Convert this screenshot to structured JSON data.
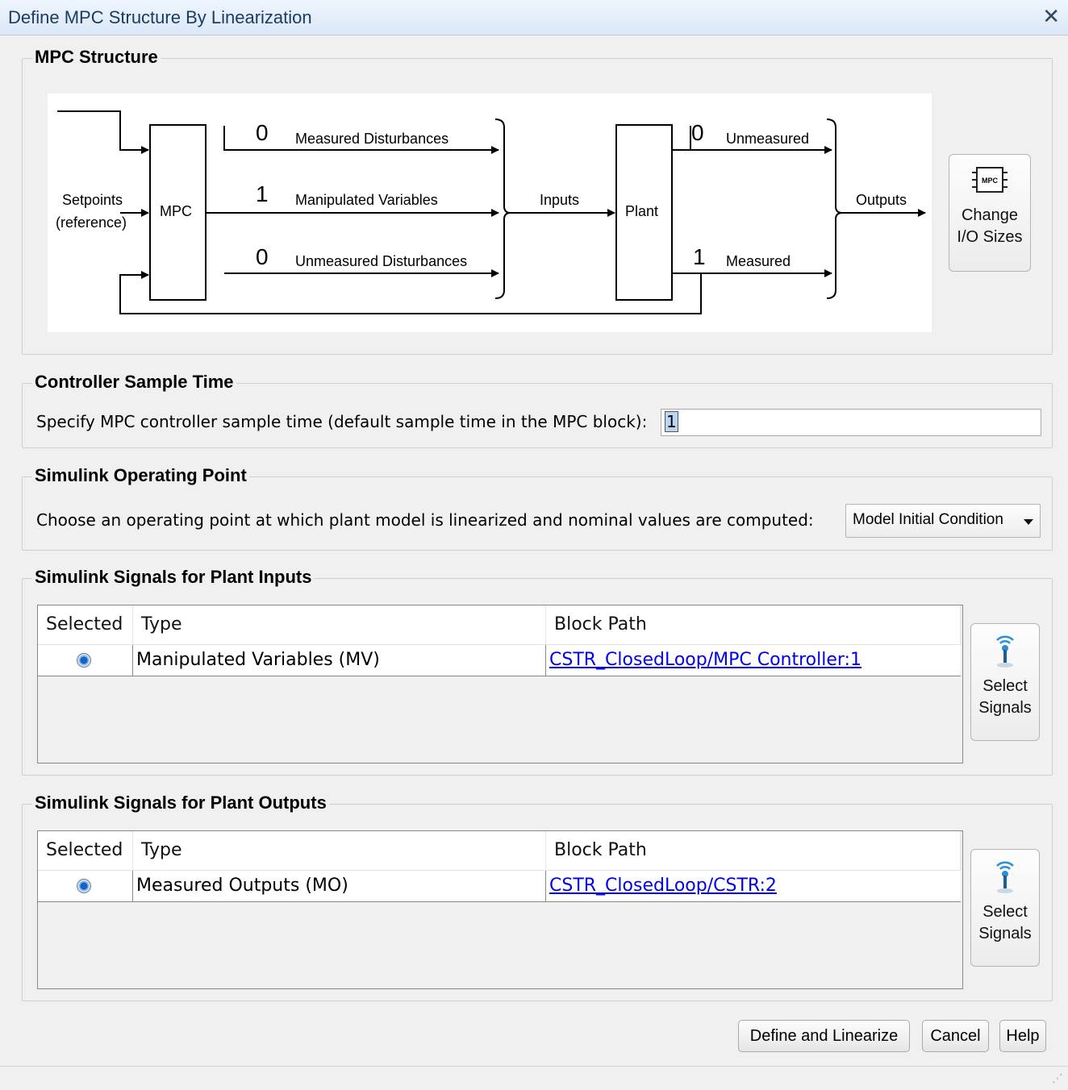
{
  "window": {
    "title": "Define MPC Structure By Linearization",
    "close_glyph": "✕"
  },
  "mpc_structure": {
    "legend": "MPC Structure",
    "diagram": {
      "setpoints_label": "Setpoints",
      "reference_label": "(reference)",
      "mpc_block": "MPC",
      "plant_block": "Plant",
      "inputs_label": "Inputs",
      "outputs_label": "Outputs",
      "measured_disturbances_count": "0",
      "measured_disturbances_label": "Measured Disturbances",
      "manipulated_variables_count": "1",
      "manipulated_variables_label": "Manipulated Variables",
      "unmeasured_disturbances_count": "0",
      "unmeasured_disturbances_label": "Unmeasured Disturbances",
      "unmeasured_outputs_count": "0",
      "unmeasured_outputs_label": "Unmeasured",
      "measured_outputs_count": "1",
      "measured_outputs_label": "Measured"
    },
    "change_io_button": {
      "line1": "Change",
      "line2": "I/O Sizes",
      "icon_text": "MPC",
      "icon": "mpc-chip-icon"
    }
  },
  "sample_time": {
    "legend": "Controller Sample Time",
    "label": "Specify MPC controller sample time (default sample time in the MPC block):",
    "value": "1"
  },
  "operating_point": {
    "legend": "Simulink Operating Point",
    "label": "Choose an operating point at which plant model is linearized and nominal values are computed:",
    "selected": "Model Initial Condition"
  },
  "plant_inputs": {
    "legend": "Simulink Signals for Plant Inputs",
    "columns": [
      "Selected",
      "Type",
      "Block Path"
    ],
    "rows": [
      {
        "type": "Manipulated Variables (MV)",
        "path": "CSTR_ClosedLoop/MPC Controller:1"
      }
    ],
    "select_button": {
      "line1": "Select",
      "line2": "Signals",
      "icon": "signal-probe-icon"
    }
  },
  "plant_outputs": {
    "legend": "Simulink Signals for Plant Outputs",
    "columns": [
      "Selected",
      "Type",
      "Block Path"
    ],
    "rows": [
      {
        "type": "Measured Outputs (MO)",
        "path": "CSTR_ClosedLoop/CSTR:2"
      }
    ],
    "select_button": {
      "line1": "Select",
      "line2": "Signals",
      "icon": "signal-probe-icon"
    }
  },
  "buttons": {
    "define": "Define and Linearize",
    "cancel": "Cancel",
    "help": "Help"
  },
  "colors": {
    "link": "#0000ee",
    "accent": "#1565c0"
  }
}
